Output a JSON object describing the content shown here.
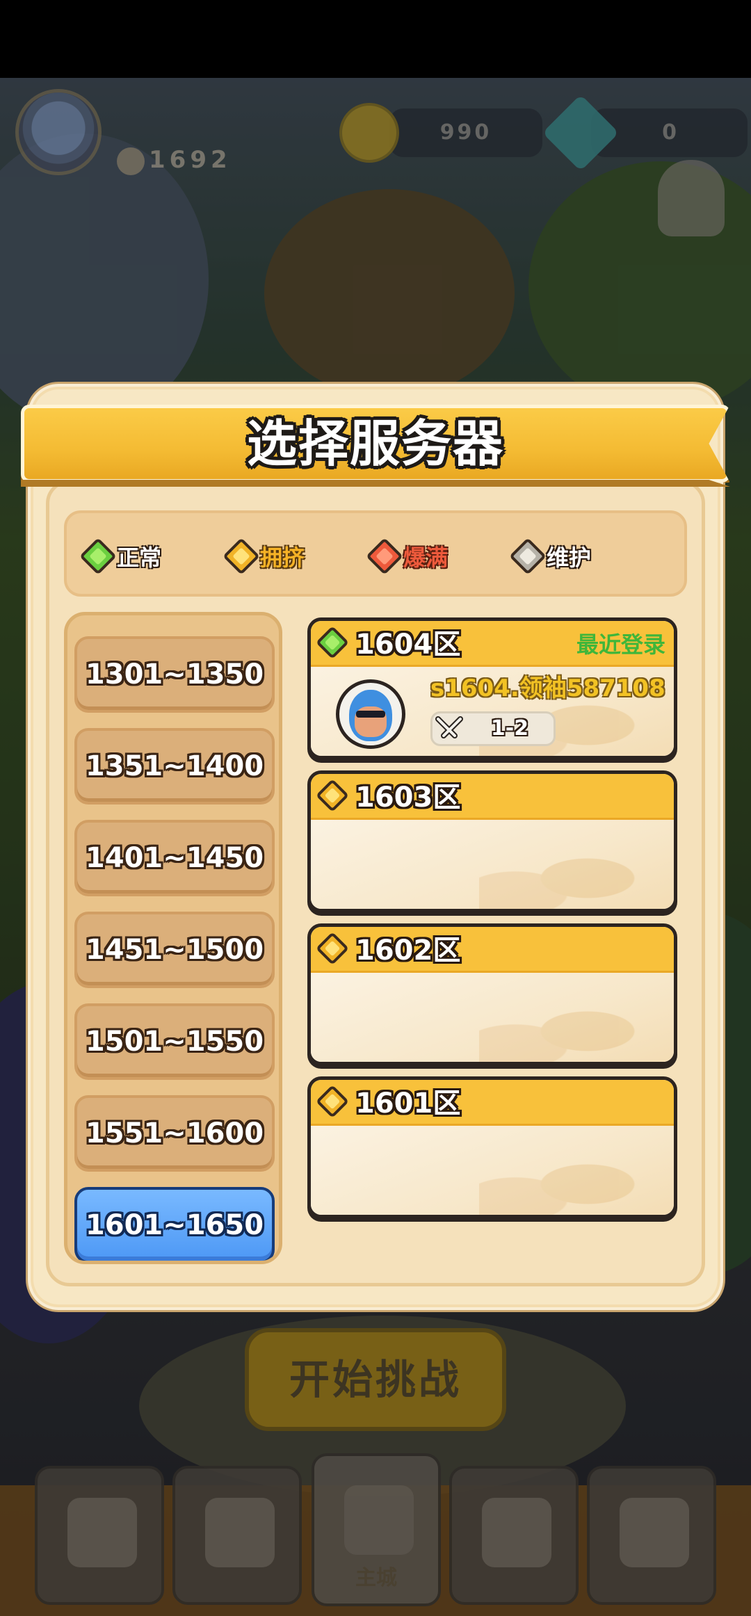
{
  "hud": {
    "level_text": "1692",
    "coins_text": "990",
    "gems_text": "0",
    "start_button_label": "开始挑战",
    "nav_battle_label": "主城"
  },
  "dialog": {
    "title": "选择服务器",
    "legend": [
      {
        "label": "正常",
        "status": "normal",
        "color": "#6bd040",
        "text_color": "#ffffff"
      },
      {
        "label": "拥挤",
        "status": "crowded",
        "color": "#f1b327",
        "text_color": "#f6b226"
      },
      {
        "label": "爆满",
        "status": "full",
        "color": "#ee5a3c",
        "text_color": "#ee5a3c"
      },
      {
        "label": "维护",
        "status": "maintenance",
        "color": "#b6b2a8",
        "text_color": "#ffffff"
      }
    ],
    "ranges": [
      {
        "label": "1301~1350区",
        "selected": false
      },
      {
        "label": "1351~1400区",
        "selected": false
      },
      {
        "label": "1401~1450区",
        "selected": false
      },
      {
        "label": "1451~1500区",
        "selected": false
      },
      {
        "label": "1501~1550区",
        "selected": false
      },
      {
        "label": "1551~1600区",
        "selected": false
      },
      {
        "label": "1601~1650区",
        "selected": true
      }
    ],
    "servers": [
      {
        "name": "1604区",
        "status": "normal",
        "recent_label": "最近登录",
        "player_name": "s1604.领袖587108",
        "progress": "1-2"
      },
      {
        "name": "1603区",
        "status": "crowded"
      },
      {
        "name": "1602区",
        "status": "crowded"
      },
      {
        "name": "1601区",
        "status": "crowded"
      }
    ]
  },
  "colors": {
    "banner": "#f8c13b",
    "selected_range": "#4d98f5",
    "recent_login": "#3fb63a",
    "player_name": "#f2c224"
  }
}
